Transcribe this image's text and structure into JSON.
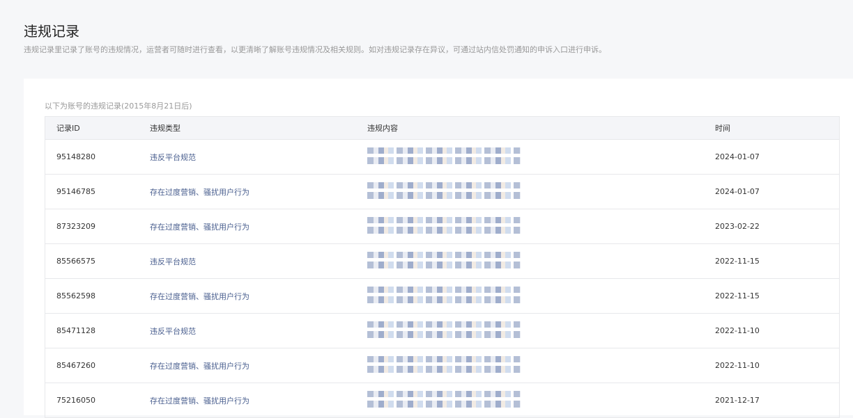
{
  "header": {
    "title": "违规记录",
    "description": "违规记录里记录了账号的违规情况，运营者可随时进行查看，以更清晰了解账号违规情况及相关规则。如对违规记录存在异议，可通过站内信处罚通知的申诉入口进行申诉。"
  },
  "table": {
    "caption": "以下为账号的违规记录(2015年8月21日后)",
    "columns": [
      "记录ID",
      "违规类型",
      "违规内容",
      "时间"
    ],
    "rows": [
      {
        "id": "95148280",
        "type": "违反平台规范",
        "date": "2024-01-07"
      },
      {
        "id": "95146785",
        "type": "存在过度营销、骚扰用户行为",
        "date": "2024-01-07"
      },
      {
        "id": "87323209",
        "type": "存在过度营销、骚扰用户行为",
        "date": "2023-02-22"
      },
      {
        "id": "85566575",
        "type": "违反平台规范",
        "date": "2022-11-15"
      },
      {
        "id": "85562598",
        "type": "存在过度营销、骚扰用户行为",
        "date": "2022-11-15"
      },
      {
        "id": "85471128",
        "type": "违反平台规范",
        "date": "2022-11-10"
      },
      {
        "id": "85467260",
        "type": "存在过度营销、骚扰用户行为",
        "date": "2022-11-10"
      },
      {
        "id": "75216050",
        "type": "存在过度营销、骚扰用户行为",
        "date": "2021-12-17"
      }
    ]
  }
}
